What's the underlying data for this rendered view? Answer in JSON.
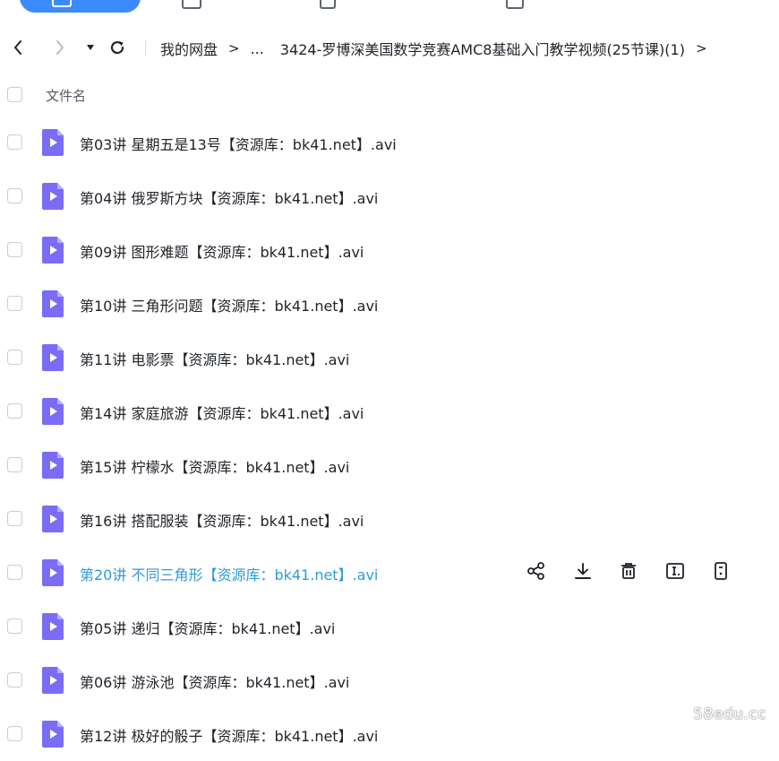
{
  "colors": {
    "accent": "#3b8bff",
    "link_hover": "#2e9bd6",
    "video_icon": "#7b6cf6"
  },
  "nav": {
    "back_icon": "chevron-left-icon",
    "forward_icon": "chevron-right-icon",
    "dropdown_icon": "caret-down-icon",
    "refresh_icon": "refresh-icon"
  },
  "breadcrumb": {
    "root": "我的网盘",
    "sep": ">",
    "ellipsis": "...",
    "current": "3424-罗博深美国数学竞赛AMC8基础入门教学视频(25节课)(1)"
  },
  "table": {
    "header": "文件名"
  },
  "files": [
    {
      "name": "第03讲 星期五是13号【资源库：bk41.net】.avi"
    },
    {
      "name": "第04讲 俄罗斯方块【资源库：bk41.net】.avi"
    },
    {
      "name": "第09讲 图形难题【资源库：bk41.net】.avi"
    },
    {
      "name": "第10讲 三角形问题【资源库：bk41.net】.avi"
    },
    {
      "name": "第11讲 电影票【资源库：bk41.net】.avi"
    },
    {
      "name": "第14讲 家庭旅游【资源库：bk41.net】.avi"
    },
    {
      "name": "第15讲 柠檬水【资源库：bk41.net】.avi"
    },
    {
      "name": "第16讲 搭配服装【资源库：bk41.net】.avi"
    },
    {
      "name": "第20讲 不同三角形【资源库：bk41.net】.avi"
    },
    {
      "name": "第05讲 递归【资源库：bk41.net】.avi"
    },
    {
      "name": "第06讲 游泳池【资源库：bk41.net】.avi"
    },
    {
      "name": "第12讲 极好的骰子【资源库：bk41.net】.avi"
    }
  ],
  "row_actions": [
    "share-icon",
    "download-icon",
    "delete-icon",
    "rename-icon",
    "more-icon"
  ],
  "watermark": "58edu.cc"
}
